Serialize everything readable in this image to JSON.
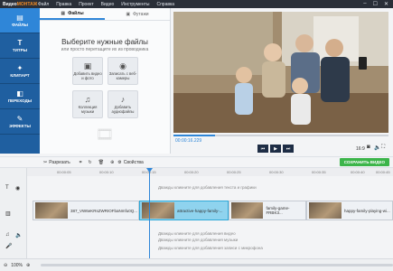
{
  "app": {
    "logo_a": "Видео",
    "logo_b": "МОНТАЖ"
  },
  "menu": [
    "Файл",
    "Правка",
    "Проект",
    "Видео",
    "Инструменты",
    "Справка"
  ],
  "sidebar": [
    {
      "label": "ФАЙЛЫ",
      "icon": "folder-icon"
    },
    {
      "label": "ТИТРЫ",
      "icon": "titles-icon"
    },
    {
      "label": "КЛИПАРТ",
      "icon": "clipart-icon"
    },
    {
      "label": "ПЕРЕХОДЫ",
      "icon": "transitions-icon"
    },
    {
      "label": "ЭФФЕКТЫ",
      "icon": "effects-icon"
    }
  ],
  "library": {
    "tabs": [
      {
        "label": "Файлы"
      },
      {
        "label": "Футажи"
      }
    ],
    "title": "Выберите нужные файлы",
    "subtitle": "или просто перетащите их из проводника",
    "cards": [
      {
        "label": "Добавить видео и фото",
        "icon": "add-media-icon"
      },
      {
        "label": "Записать с веб-камеры",
        "icon": "webcam-icon"
      },
      {
        "label": "Коллекция музыки",
        "icon": "music-icon"
      },
      {
        "label": "Добавить аудиофайлы",
        "icon": "add-audio-icon"
      }
    ]
  },
  "player": {
    "time": "00:00:16.229",
    "ratio": "16:9"
  },
  "toolbar": {
    "cut": "Разрезать",
    "props": "Свойства",
    "export": "СОХРАНИТЬ ВИДЕО"
  },
  "ruler": [
    "00:00:05",
    "00:00:10",
    "00:00:15",
    "00:00:20",
    "00:00:25",
    "00:00:30",
    "00:00:35",
    "00:00:40",
    "00:00:45"
  ],
  "hints": {
    "text": "Дважды кликните для добавления текста и графики",
    "overlay": "Дважды кликните для добавления видео",
    "music": "Дважды кликните для добавления музыки",
    "voice": "Дважды кликните для добавления записи с микрофона"
  },
  "clips": [
    "387_VW6eKRsZWRIOFbaNmfu0Q...",
    "attractive-happy-family-...",
    "family-game-FRBK3...",
    "happy-family-playing-wi..."
  ],
  "status": {
    "zoom": "100%"
  },
  "colors": {
    "accent": "#2f86d8",
    "export": "#3cb54a",
    "sidebar": "#1f5fa0"
  }
}
